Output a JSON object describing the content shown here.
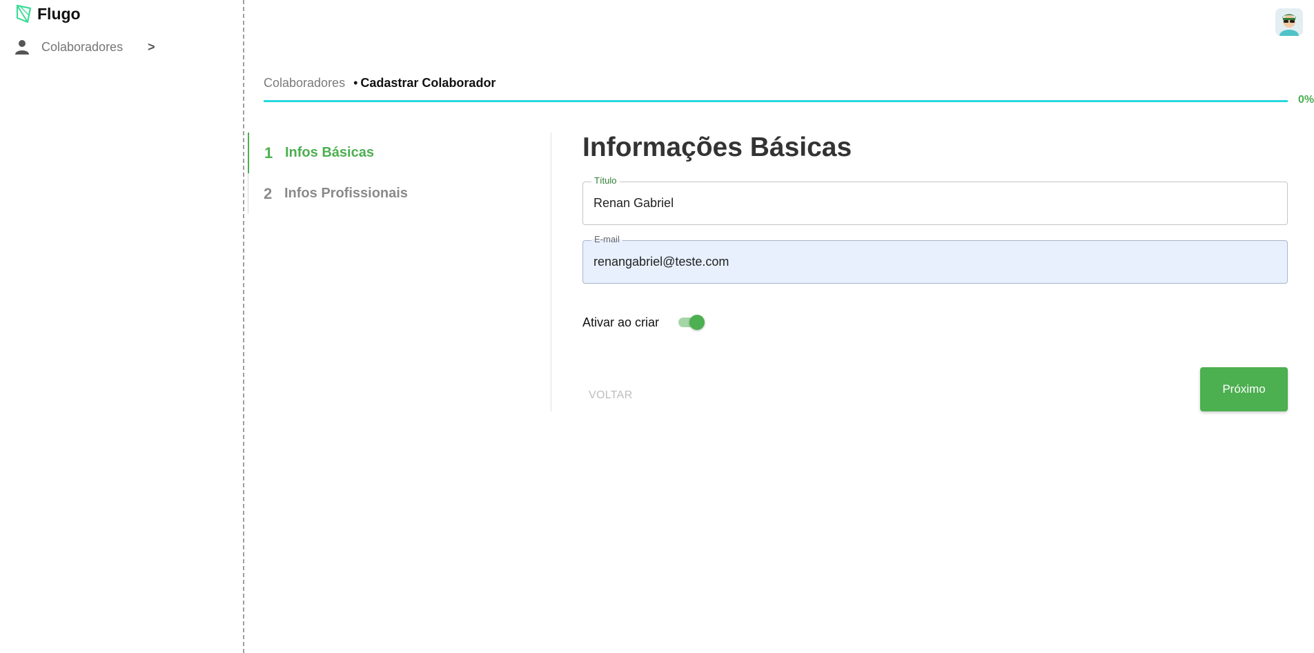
{
  "sidebar": {
    "brand": "Flugo",
    "items": [
      {
        "label": "Colaboradores",
        "arrow": ">"
      }
    ]
  },
  "breadcrumb": {
    "root": "Colaboradores",
    "separator": "•",
    "current": "Cadastrar Colaborador"
  },
  "progress": {
    "value": 0,
    "text": "0%"
  },
  "steps": [
    {
      "number": "1",
      "label": "Infos Básicas",
      "active": true
    },
    {
      "number": "2",
      "label": "Infos Profissionais",
      "active": false
    }
  ],
  "form": {
    "title": "Informações Básicas",
    "fields": [
      {
        "label": "Título",
        "value": "Renan Gabriel"
      },
      {
        "label": "E-mail",
        "value": "renangabriel@teste.com"
      }
    ],
    "toggle": {
      "label": "Ativar ao criar",
      "checked": true
    },
    "back_label": "VOLTAR",
    "next_label": "Próximo"
  },
  "colors": {
    "accent": "#4caf50",
    "progress": "#26d7e0"
  }
}
